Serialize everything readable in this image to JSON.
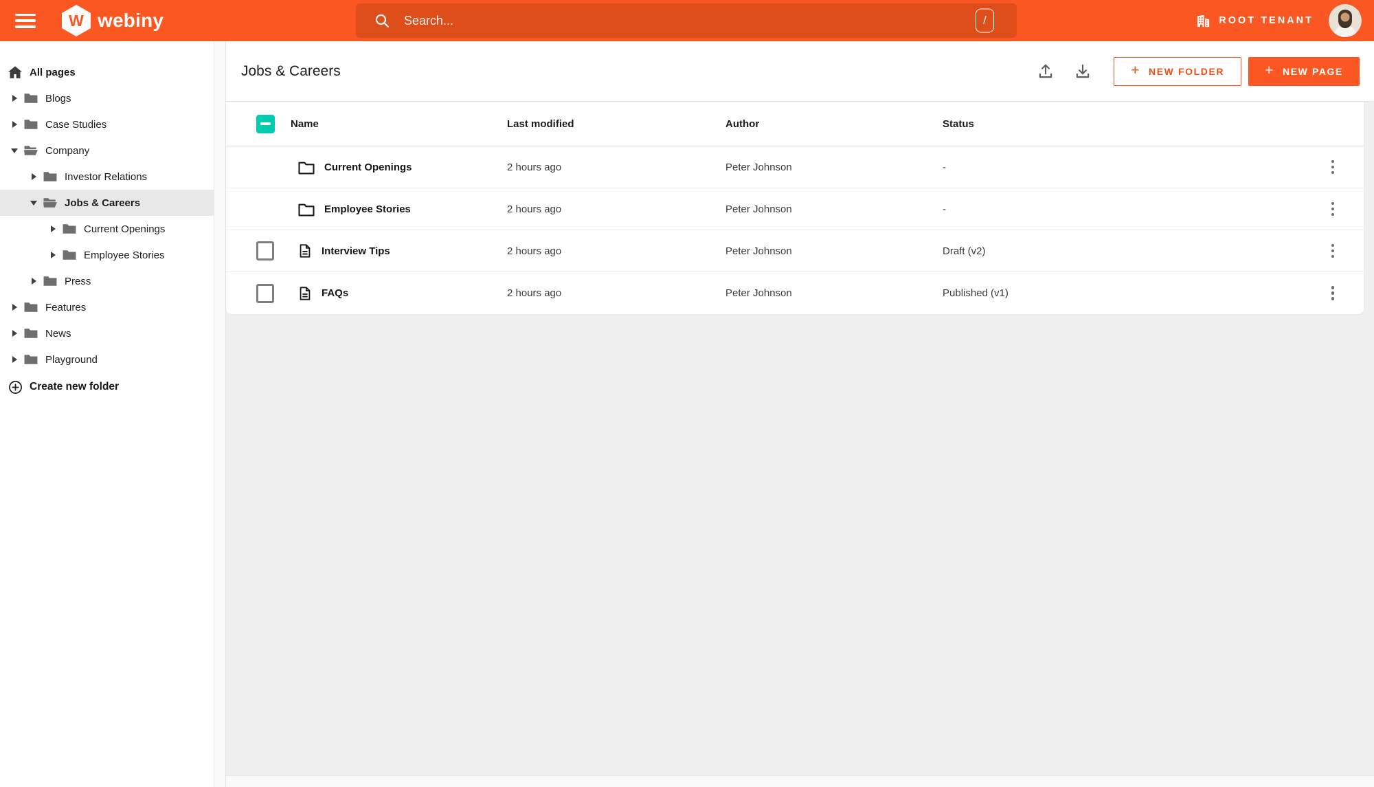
{
  "topbar": {
    "brand": "webiny",
    "search": {
      "placeholder": "Search...",
      "shortcut_key": "/"
    },
    "tenant_label": "ROOT TENANT"
  },
  "sidebar": {
    "root_label": "All pages",
    "items": [
      {
        "label": "Blogs",
        "level": 0,
        "expanded": false,
        "selected": false
      },
      {
        "label": "Case Studies",
        "level": 0,
        "expanded": false,
        "selected": false
      },
      {
        "label": "Company",
        "level": 0,
        "expanded": true,
        "selected": false
      },
      {
        "label": "Investor Relations",
        "level": 1,
        "expanded": false,
        "selected": false
      },
      {
        "label": "Jobs & Careers",
        "level": 1,
        "expanded": true,
        "selected": true
      },
      {
        "label": "Current Openings",
        "level": 2,
        "expanded": false,
        "selected": false
      },
      {
        "label": "Employee Stories",
        "level": 2,
        "expanded": false,
        "selected": false
      },
      {
        "label": "Press",
        "level": 1,
        "expanded": false,
        "selected": false
      },
      {
        "label": "Features",
        "level": 0,
        "expanded": false,
        "selected": false
      },
      {
        "label": "News",
        "level": 0,
        "expanded": false,
        "selected": false
      },
      {
        "label": "Playground",
        "level": 0,
        "expanded": false,
        "selected": false
      }
    ],
    "create_folder_label": "Create new folder"
  },
  "main": {
    "title": "Jobs & Careers",
    "actions": {
      "new_folder": "NEW FOLDER",
      "new_page": "NEW PAGE"
    },
    "table": {
      "columns": [
        "Name",
        "Last modified",
        "Author",
        "Status"
      ],
      "select_all_state": "indeterminate",
      "rows": [
        {
          "type": "folder",
          "name": "Current Openings",
          "last_modified": "2 hours ago",
          "author": "Peter Johnson",
          "status": "-",
          "has_checkbox": false,
          "checked": false
        },
        {
          "type": "folder",
          "name": "Employee Stories",
          "last_modified": "2 hours ago",
          "author": "Peter Johnson",
          "status": "-",
          "has_checkbox": false,
          "checked": false
        },
        {
          "type": "page",
          "name": "Interview Tips",
          "last_modified": "2 hours ago",
          "author": "Peter Johnson",
          "status": "Draft (v2)",
          "has_checkbox": true,
          "checked": false
        },
        {
          "type": "page",
          "name": "FAQs",
          "last_modified": "2 hours ago",
          "author": "Peter Johnson",
          "status": "Published (v1)",
          "has_checkbox": true,
          "checked": false
        }
      ]
    }
  },
  "colors": {
    "topbar_orange": "#fa5723",
    "search_orange": "#de4e1b",
    "accent_orange": "#f04d18",
    "checkbox_teal": "#00ccb0",
    "selected_gray": "#e8e8e8",
    "content_bg": "#f0f0f1"
  }
}
